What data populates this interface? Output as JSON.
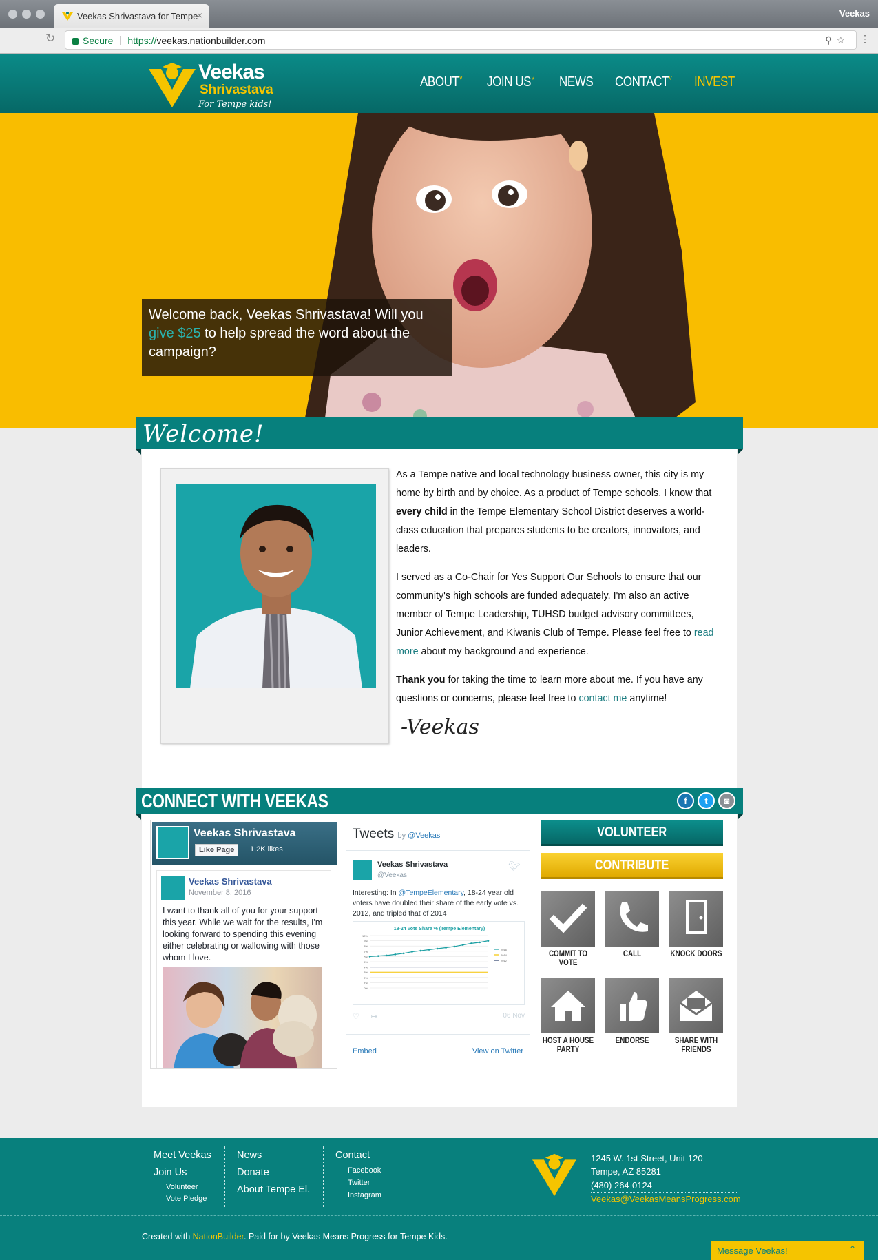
{
  "browser": {
    "tab_title": "Veekas Shrivastava for Tempe",
    "tab_close": "×",
    "profile_name": "Veekas",
    "secure_label": "Secure",
    "url_scheme": "https://",
    "url_host": "veekas.nationbuilder.com"
  },
  "logo": {
    "line1": "Veekas",
    "line2": "Shrivastava",
    "tagline": "For Tempe kids!"
  },
  "nav": {
    "about": "ABOUT",
    "join_us": "JOIN US",
    "news": "NEWS",
    "contact": "CONTACT",
    "invest": "INVEST",
    "caret": "˅"
  },
  "hero": {
    "callout_before": "Welcome back, Veekas Shrivastava! Will you ",
    "callout_link": "give $25",
    "callout_after": " to help spread the word about the campaign?"
  },
  "welcome": {
    "title": "Welcome!",
    "p1_a": "As a Tempe native and local technology business owner, this city is my home by birth and by choice. As a product of Tempe schools, I know that ",
    "p1_bold": "every child",
    "p1_b": " in the Tempe Elementary School District deserves a world-class education that prepares students to be creators, innovators, and leaders.",
    "p2_a": "I served as a Co-Chair for Yes Support Our Schools to ensure that our community's high schools are funded adequately. I'm also an active member of Tempe Leadership, TUHSD budget advisory committees, Junior Achievement, and Kiwanis Club of Tempe. Please feel free to ",
    "p2_link": "read more",
    "p2_b": " about my background and experience.",
    "p3_bold": "Thank you",
    "p3_a": " for taking the time to learn more about me. If you have any questions or concerns, please feel free to ",
    "p3_link": "contact me",
    "p3_b": " anytime!",
    "signature": "-Veekas"
  },
  "connect": {
    "title": "CONNECT WITH VEEKAS",
    "social": [
      "f",
      "t",
      "◙"
    ]
  },
  "facebook": {
    "page_name": "Veekas Shrivastava",
    "like_label": "Like Page",
    "likes": "1.2K likes",
    "post_author": "Veekas Shrivastava",
    "post_date": "November 8, 2016",
    "post_text": "I want to thank all of you for your support this year. While we wait for the results, I'm looking forward to spending this evening either celebrating or wallowing with those whom I love."
  },
  "twitter": {
    "title": "Tweets",
    "by": "by ",
    "handle_link": "@Veekas",
    "author": "Veekas Shrivastava",
    "author_handle": "@Veekas",
    "text_a": "Interesting: In ",
    "mention": "@TempeElementary",
    "text_b": ", 18-24 year old voters have doubled their share of the early vote vs. 2012, and tripled that of 2014",
    "date": "06 Nov",
    "embed": "Embed",
    "view": "View on Twitter"
  },
  "chart_data": {
    "type": "line",
    "title": "18-24 Vote Share % (Tempe Elementary)",
    "ylim": [
      0,
      10
    ],
    "y_ticks": [
      "10%",
      "9%",
      "8%",
      "7%",
      "6%",
      "5%",
      "4%",
      "3%",
      "2%",
      "1%",
      "0%"
    ],
    "series": [
      {
        "name": "2016",
        "color": "#1a9fa3",
        "values": [
          6.0,
          6.1,
          6.2,
          6.4,
          6.6,
          6.9,
          7.1,
          7.3,
          7.5,
          7.7,
          7.9,
          8.2,
          8.5,
          8.7,
          9.0
        ]
      },
      {
        "name": "2014",
        "color": "#f5c400",
        "values": [
          3.0,
          3.0,
          3.0,
          3.0,
          3.0,
          3.0,
          3.0,
          3.0,
          3.0,
          3.0,
          3.0,
          3.0,
          3.0,
          3.0,
          3.0
        ]
      },
      {
        "name": "2012",
        "color": "#2a3f6b",
        "values": [
          4.0,
          4.0,
          4.0,
          4.0,
          4.0,
          4.0,
          4.0,
          4.0,
          4.0,
          4.0,
          4.0,
          4.0,
          4.0,
          4.0,
          4.0
        ]
      }
    ],
    "grid": true,
    "legend": "right"
  },
  "actions": {
    "volunteer": "VOLUNTEER",
    "contribute": "CONTRIBUTE",
    "tiles": [
      {
        "label": "COMMIT TO VOTE",
        "icon": "check-icon"
      },
      {
        "label": "CALL",
        "icon": "phone-icon"
      },
      {
        "label": "KNOCK DOORS",
        "icon": "door-icon"
      },
      {
        "label": "HOST A HOUSE PARTY",
        "icon": "house-icon"
      },
      {
        "label": "ENDORSE",
        "icon": "thumbs-up-icon"
      },
      {
        "label": "SHARE WITH FRIENDS",
        "icon": "envelope-icon"
      }
    ]
  },
  "footer": {
    "col1": {
      "meet": "Meet Veekas",
      "join": "Join Us",
      "volunteer": "Volunteer",
      "pledge": "Vote Pledge"
    },
    "col2": {
      "news": "News",
      "donate": "Donate",
      "about": "About Tempe El."
    },
    "col3": {
      "contact": "Contact",
      "facebook": "Facebook",
      "twitter": "Twitter",
      "instagram": "Instagram"
    },
    "address1": "1245 W. 1st Street, Unit 120",
    "address2": "Tempe, AZ 85281",
    "phone": "(480) 264-0124",
    "email": "Veekas@VeekasMeansProgress.com",
    "credit_a": "Created with ",
    "credit_link": "NationBuilder",
    "credit_b": ". Paid for by Veekas Means Progress for Tempe Kids.",
    "message_label": "Message Veekas!",
    "message_chevron": "⌃"
  },
  "colors": {
    "teal": "#07807d",
    "yellow": "#f5c400",
    "hero_yellow": "#f9bd00"
  }
}
